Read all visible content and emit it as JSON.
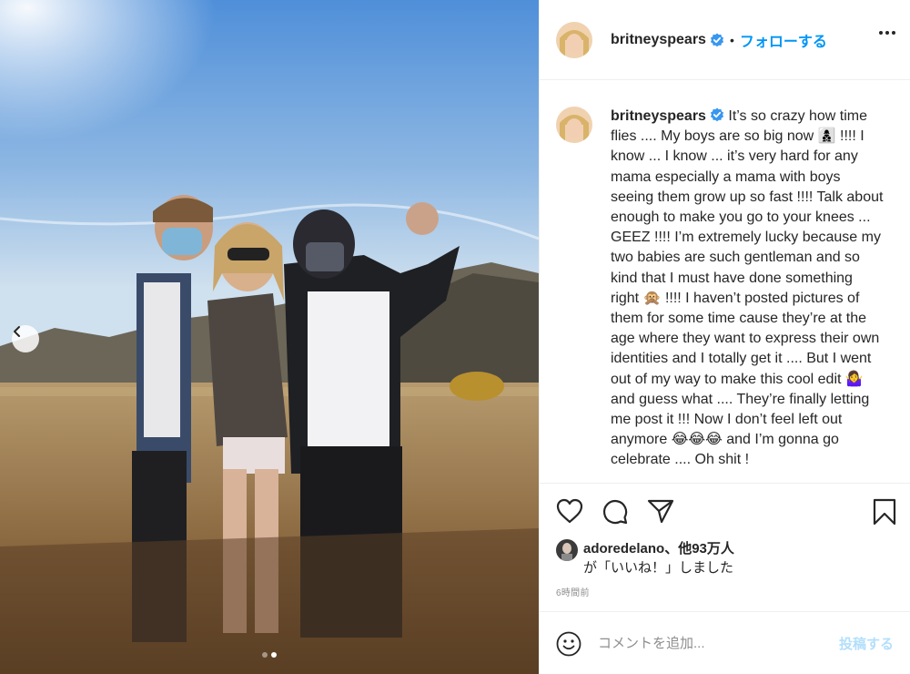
{
  "post": {
    "photo_alt": "",
    "carousel": {
      "total": 2,
      "active": 2
    }
  },
  "header": {
    "username": "britneyspears",
    "separator": "•",
    "follow_label": "フォローする"
  },
  "caption": {
    "username": "britneyspears",
    "text": "It’s so crazy how time flies .... My boys are so big now 👩‍👦‍👦 !!!! I know ... I know ... it’s very hard for any mama especially a mama with boys seeing them grow up so fast !!!! Talk about enough to make you go to your knees ... GEEZ  !!!! I’m extremely lucky because my two babies are such gentleman and so kind that I must have done something right 🙊 !!!! I haven’t posted pictures of them for some time cause they’re at the age where they want to express their own identities and I totally get it .... But I went out of my way to make this cool edit 🤷‍♀️ and guess what .... They’re finally letting me post it !!! Now I don’t feel left out anymore 😂😂😂 and I’m gonna go celebrate .... Oh shit !"
  },
  "likes": {
    "liker": "adoredelano",
    "others": "、他93万人",
    "suffix": "が「いいね！」しました"
  },
  "timestamp": "6時間前",
  "comment": {
    "placeholder": "コメントを追加...",
    "post_label": "投稿する"
  },
  "colors": {
    "accent": "#0095f6",
    "verified": "#3897f0",
    "post_disabled": "#b2dffc",
    "muted": "#8e8e8e"
  },
  "icons": [
    "chevron-left-icon",
    "verified-badge-icon",
    "more-options-icon",
    "heart-icon",
    "comment-icon",
    "share-icon",
    "bookmark-icon",
    "emoji-icon"
  ]
}
